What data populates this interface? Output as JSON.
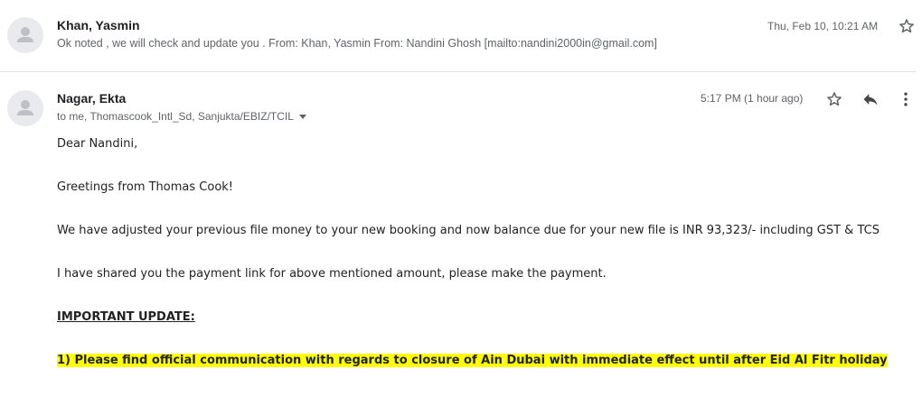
{
  "thread": {
    "collapsed_message": {
      "sender": "Khan, Yasmin",
      "snippet": "Ok noted , we will check and update you . From: Khan, Yasmin From: Nandini Ghosh [mailto:nandini2000in@gmail.com]",
      "date": "Thu, Feb 10, 10:21 AM",
      "icons": {
        "star": "star-icon"
      }
    },
    "open_message": {
      "sender": "Nagar, Ekta",
      "recipients": "to me, Thomascook_Intl_Sd, Sanjukta/EBIZ/TCIL",
      "date": "5:17 PM (1 hour ago)",
      "icons": {
        "star": "star-icon",
        "reply": "reply-icon",
        "more": "more-vert-icon"
      },
      "body": {
        "greeting": "Dear Nandini,",
        "line1": "Greetings from Thomas Cook!",
        "line2": "We have adjusted your previous file money to your new booking and now balance due for your new file is INR 93,323/- including GST & TCS",
        "line3": "I have shared you the payment link for above mentioned amount, please make the payment.",
        "important_heading": "IMPORTANT UPDATE:",
        "highlight_line": "1) Please find official communication with regards to closure of Ain Dubai with immediate effect until after Eid Al Fitr holiday"
      }
    }
  },
  "colors": {
    "highlight": "#ffff00",
    "avatar_bg": "#e8eaed",
    "avatar_fg": "#bdc1c6",
    "secondary_text": "#5f6368"
  }
}
